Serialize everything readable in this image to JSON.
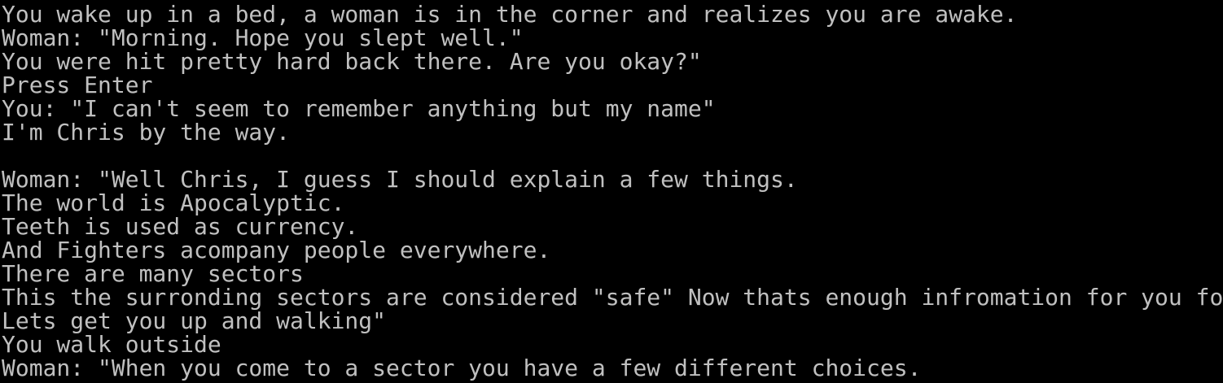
{
  "console": {
    "lines": [
      "You wake up in a bed, a woman is in the corner and realizes you are awake.",
      "Woman: \"Morning. Hope you slept well.\"",
      "You were hit pretty hard back there. Are you okay?\"",
      "Press Enter",
      "You: \"I can't seem to remember anything but my name\"",
      "I'm Chris by the way.",
      "",
      "Woman: \"Well Chris, I guess I should explain a few things.",
      "The world is Apocalyptic.",
      "Teeth is used as currency.",
      "And Fighters acompany people everywhere.",
      "There are many sectors",
      "This the surronding sectors are considered \"safe\" Now thats enough infromation for you fo",
      "Lets get you up and walking\"",
      "You walk outside",
      "Woman: \"When you come to a sector you have a few different choices."
    ],
    "colors": {
      "background": "#000000",
      "text": "#c0c0c0"
    }
  }
}
